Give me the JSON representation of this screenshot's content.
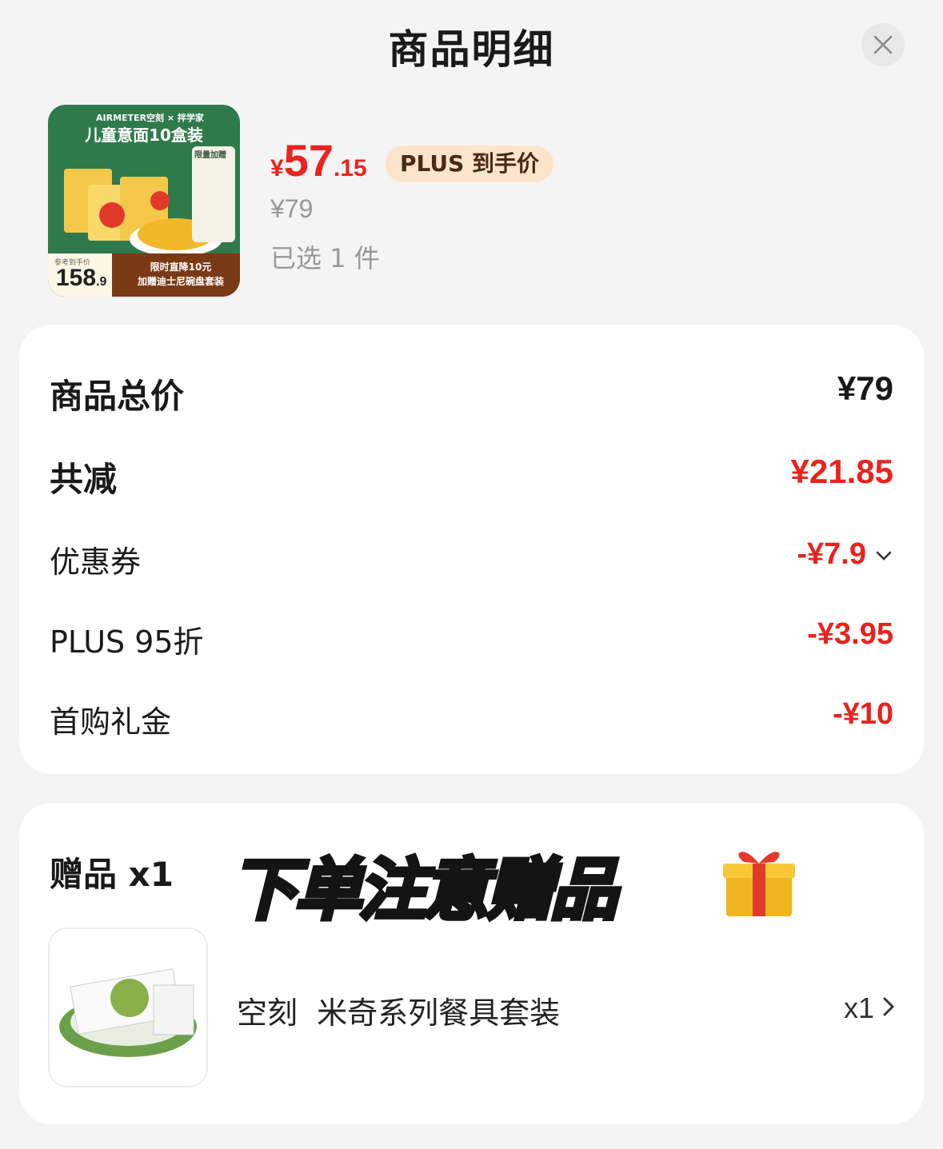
{
  "header": {
    "title": "商品明细"
  },
  "product": {
    "image": {
      "brand": "AIRMETER空刻 × 拌学家",
      "title": "儿童意面10盒装",
      "tag": "限量加赠",
      "price_label": "参考到手价",
      "price_int": "158",
      "price_dec": ".9",
      "promo_line1": "限时直降10元",
      "promo_line2": "加赠迪士尼碗盘套装"
    },
    "price_symbol": "¥",
    "price_int": "57",
    "price_dec": ".15",
    "badge": "PLUS 到手价",
    "original_price": "¥79",
    "selected": "已选 1 件"
  },
  "summary": {
    "total_label": "商品总价",
    "total_value": "¥79",
    "discount_label": "共减",
    "discount_value": "¥21.85",
    "items": [
      {
        "label": "优惠券",
        "value": "-¥7.9"
      },
      {
        "label": "PLUS 95折",
        "value": "-¥3.95"
      },
      {
        "label": "首购礼金",
        "value": "-¥10"
      }
    ]
  },
  "gift": {
    "title": "赠品 x1",
    "banner": "下单注意赠品",
    "name": "空刻  米奇系列餐具套装",
    "qty": "x1"
  },
  "colors": {
    "accent_red": "#e8231e",
    "badge_bg": "#fbe3cc",
    "banner_fill": "#f0ed9a"
  }
}
